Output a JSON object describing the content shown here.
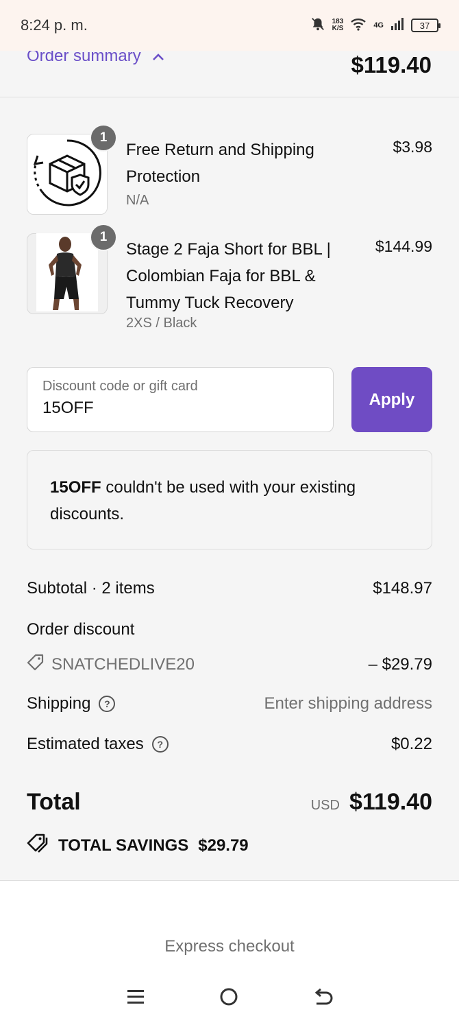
{
  "status_bar": {
    "time": "8:24 p. m.",
    "net_speed_top": "183",
    "net_speed_bottom": "K/S",
    "network": "4G",
    "battery": "37"
  },
  "summary": {
    "toggle_label": "Order summary",
    "total": "$119.40"
  },
  "items": [
    {
      "qty": "1",
      "name": "Free Return and Shipping Protection",
      "variant": "N/A",
      "price": "$3.98",
      "icon": "package-shield-icon"
    },
    {
      "qty": "1",
      "name": "Stage 2 Faja Short for BBL | Colombian Faja for BBL & Tummy Tuck Recovery",
      "variant": "2XS / Black",
      "price": "$144.99",
      "icon": "product-photo"
    }
  ],
  "discount": {
    "placeholder": "Discount code or gift card",
    "value": "15OFF",
    "apply_label": "Apply",
    "notice_code": "15OFF",
    "notice_text": " couldn't be used with your existing discounts."
  },
  "totals": {
    "subtotal_label": "Subtotal · 2 items",
    "subtotal_value": "$148.97",
    "order_discount_label": "Order discount",
    "discount_code": "SNATCHEDLIVE20",
    "discount_value": "– $29.79",
    "shipping_label": "Shipping",
    "shipping_value": "Enter shipping address",
    "taxes_label": "Estimated taxes",
    "taxes_value": "$0.22",
    "total_label": "Total",
    "currency": "USD",
    "total_value": "$119.40",
    "savings_label": "TOTAL SAVINGS",
    "savings_value": "$29.79"
  },
  "express_checkout": "Express checkout",
  "colors": {
    "accent": "#6f4cc4",
    "link": "#6a4fc8",
    "badge": "#6b6b6b"
  }
}
